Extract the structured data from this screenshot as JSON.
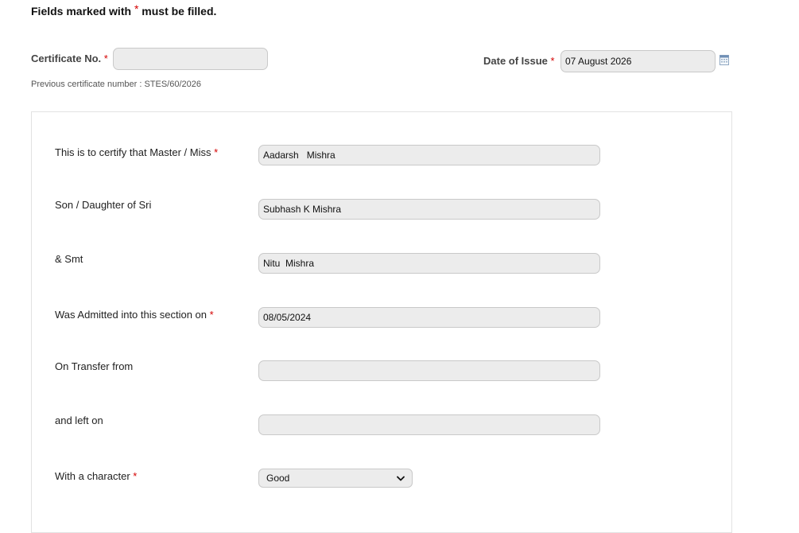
{
  "notice": {
    "prefix": "Fields marked with",
    "star": "*",
    "suffix": "must be filled."
  },
  "certificate": {
    "label": "Certificate No.",
    "value": "",
    "previous_note": "Previous certificate number : STES/60/2026"
  },
  "date_of_issue": {
    "label": "Date of Issue",
    "value": "07 August 2026"
  },
  "form": {
    "fields": [
      {
        "label": "This is to certify that Master / Miss",
        "required": true,
        "value": "Aadarsh   Mishra"
      },
      {
        "label": "Son / Daughter of Sri",
        "required": false,
        "value": "Subhash K Mishra"
      },
      {
        "label": "& Smt",
        "required": false,
        "value": "Nitu  Mishra"
      },
      {
        "label": "Was Admitted into this section on",
        "required": true,
        "value": "08/05/2024"
      },
      {
        "label": "On Transfer from",
        "required": false,
        "value": ""
      },
      {
        "label": "and left on",
        "required": false,
        "value": ""
      }
    ],
    "character": {
      "label": "With a character",
      "value": "Good"
    }
  },
  "icons": {
    "calendar": "calendar-icon",
    "dropdown": "chevron-down-icon"
  },
  "colors": {
    "required_star": "#d40000",
    "field_background": "#ececec",
    "field_border": "#c9c9c9"
  }
}
